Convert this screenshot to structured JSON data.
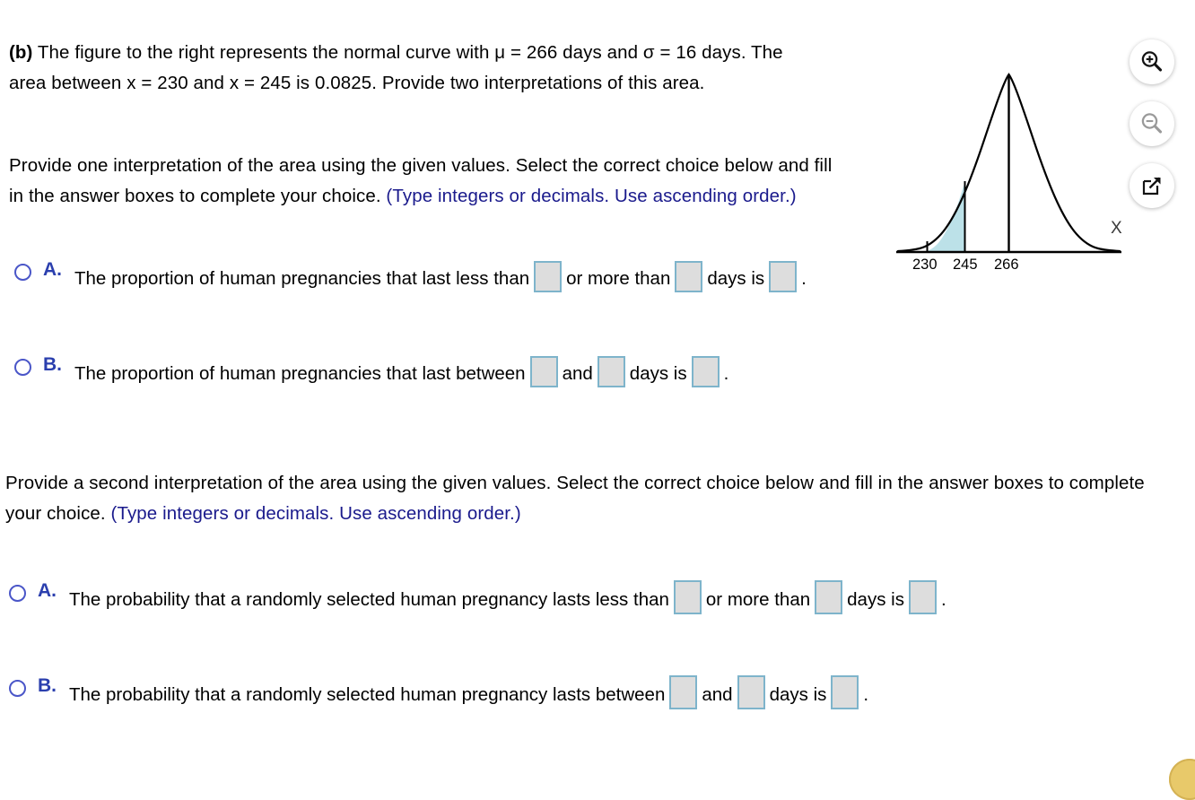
{
  "stem": {
    "label": "(b)",
    "text": " The figure to the right represents the normal curve with μ = 266 days and σ = 16 days. The area between x = 230 and x = 245 is 0.0825. Provide two interpretations of this area."
  },
  "prompt1": {
    "text": "Provide one interpretation of the area using the given values. Select the correct choice below and fill in the answer boxes to complete your choice.",
    "note": "(Type integers or decimals. Use ascending order.)"
  },
  "prompt2": {
    "text": "Provide a second interpretation of the area using the given values. Select the correct choice below and fill in the answer boxes to complete your choice.",
    "note": "(Type integers or decimals. Use ascending order.)"
  },
  "choices_1": [
    {
      "letter": "A.",
      "part1": "The proportion of human pregnancies that last less than",
      "part2": "or more than",
      "part3": "days is",
      "part4": ".",
      "box1": "",
      "box2": "",
      "box3": ""
    },
    {
      "letter": "B.",
      "part1": "The proportion of human pregnancies that last between",
      "part2": "and",
      "part3": "days is",
      "part4": ".",
      "box1": "",
      "box2": "",
      "box3": ""
    }
  ],
  "choices_2": [
    {
      "letter": "A.",
      "part1": "The probability that a randomly selected human pregnancy lasts less than",
      "part2": "or more than",
      "part3": "days is",
      "part4": ".",
      "box1": "",
      "box2": "",
      "box3": ""
    },
    {
      "letter": "B.",
      "part1": "The probability that a randomly selected human pregnancy lasts between",
      "part2": "and",
      "part3": "days is",
      "part4": ".",
      "box1": "",
      "box2": "",
      "box3": ""
    }
  ],
  "figure": {
    "axis_label": "X",
    "tick_230": "230",
    "tick_245": "245",
    "tick_266": "266",
    "shade_color": "#bce1e8",
    "curve_color": "#000000"
  },
  "toolbar": {
    "zoom_in": "zoom-in-icon",
    "zoom_out": "zoom-out-icon",
    "popout": "open-in-new-window-icon"
  },
  "chart_data": {
    "type": "line",
    "title": "",
    "xlabel": "X",
    "ylabel": "",
    "distribution": "normal",
    "mean": 266,
    "sd": 16,
    "tick_labels": [
      "230",
      "245",
      "266"
    ],
    "tick_values": [
      230,
      245,
      266
    ],
    "vertical_lines": [
      230,
      245,
      266
    ],
    "shaded_region": {
      "from": 230,
      "to": 245,
      "area": 0.0825,
      "color": "#bce1e8"
    },
    "xlim": [
      210,
      322
    ],
    "grid": false,
    "legend": null
  }
}
